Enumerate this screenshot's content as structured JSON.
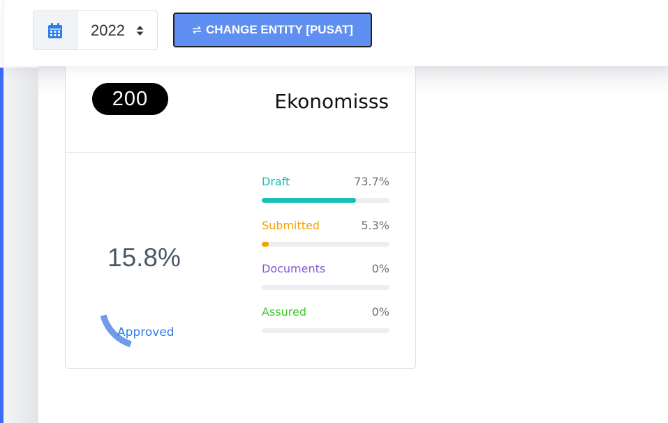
{
  "toolbar": {
    "year": "2022",
    "change_entity_label": "CHANGE ENTITY [PUSAT]",
    "icons": {
      "calendar": "calendar-icon",
      "arrows": "sort-arrows-icon",
      "swap": "swap-icon"
    }
  },
  "card": {
    "count": "200",
    "title": "Ekonomisss",
    "approved": {
      "label": "Approved",
      "value_text": "15.8%",
      "value": 15.8,
      "color": "#6f9be8"
    },
    "statuses": [
      {
        "label": "Draft",
        "value_text": "73.7%",
        "value": 73.7,
        "color": "#18c1b8"
      },
      {
        "label": "Submitted",
        "value_text": "5.3%",
        "value": 5.3,
        "color": "#f5a000"
      },
      {
        "label": "Documents",
        "value_text": "0%",
        "value": 0,
        "color": "#8a56d8"
      },
      {
        "label": "Assured",
        "value_text": "0%",
        "value": 0,
        "color": "#3ec92a"
      }
    ]
  },
  "colors": {
    "accent": "#3b6cf6",
    "button": "#5f8ff0"
  }
}
